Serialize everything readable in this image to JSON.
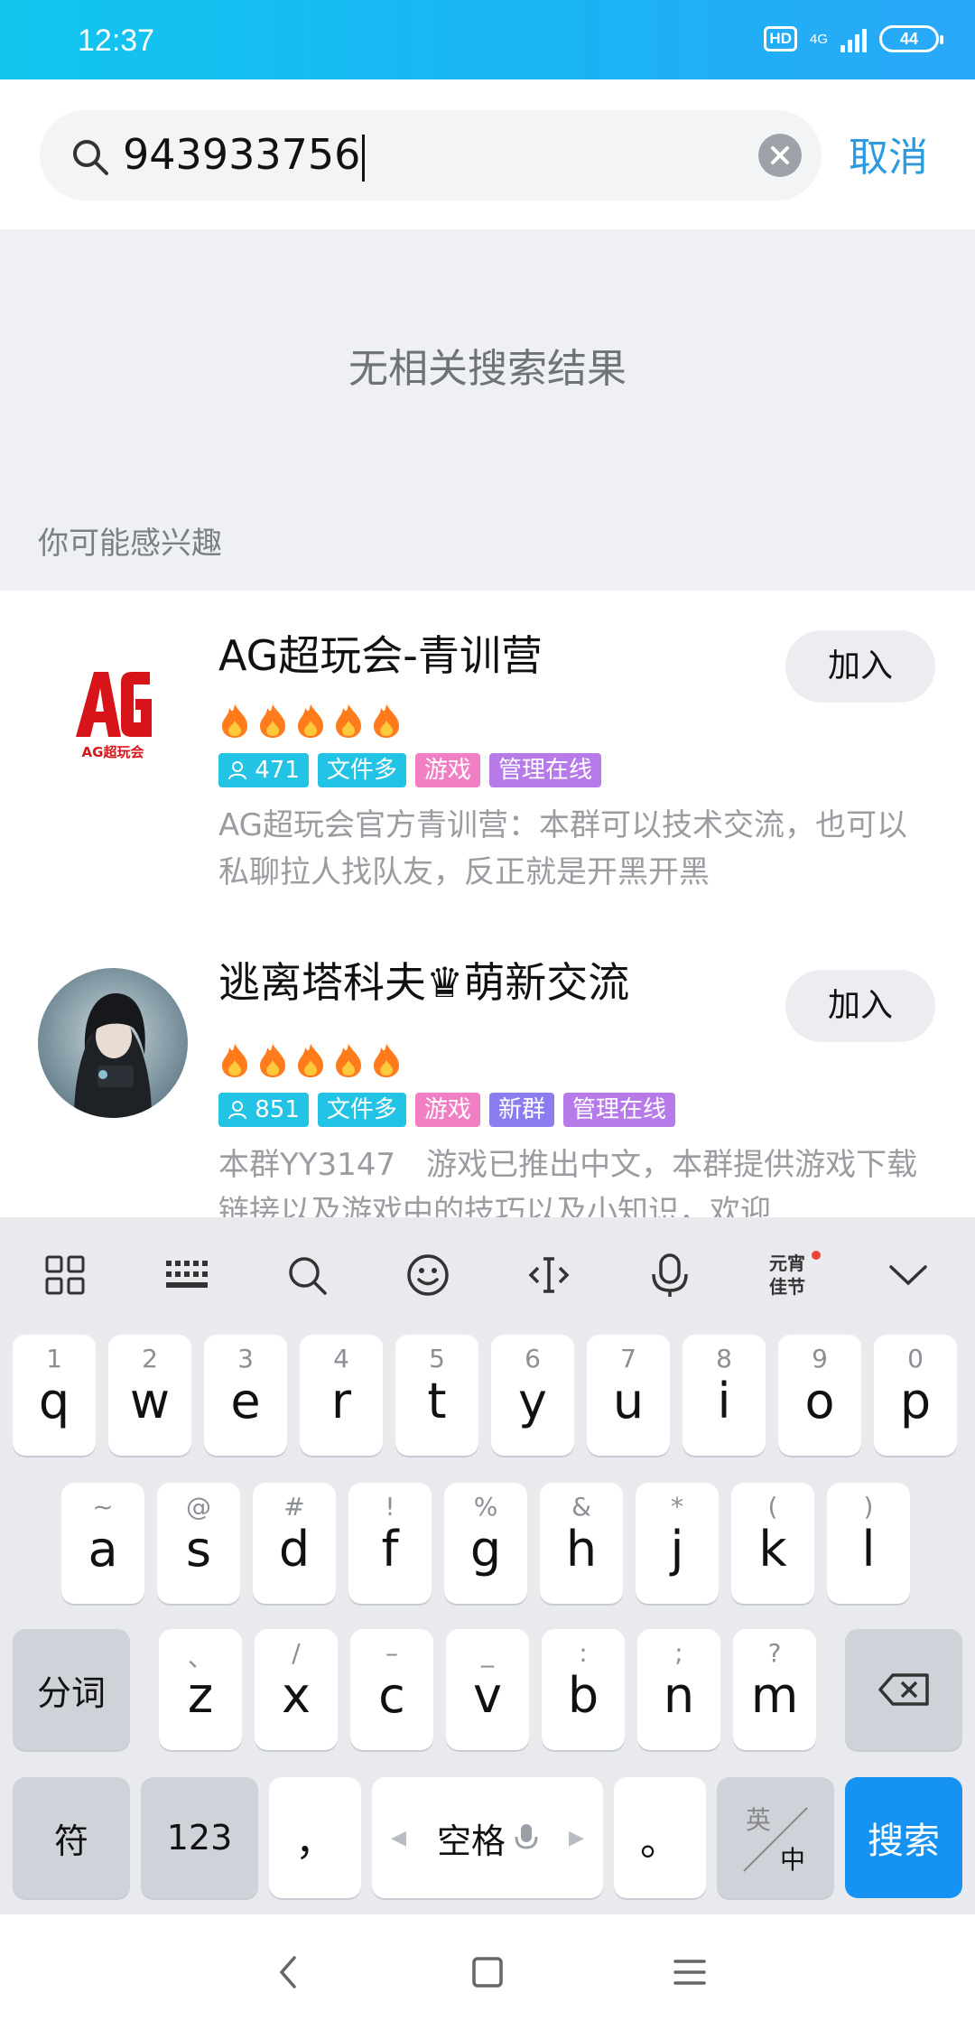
{
  "status_bar": {
    "time": "12:37",
    "hd": "HD",
    "network": "4G",
    "battery": "44"
  },
  "search": {
    "query": "943933756",
    "cancel_label": "取消"
  },
  "empty_state": {
    "message": "无相关搜索结果",
    "interest_label": "你可能感兴趣"
  },
  "results": [
    {
      "title": "AG超玩会-青训营",
      "fire_count": 5,
      "tags": [
        {
          "text": "471",
          "color": "#23c3e6",
          "icon": "person-icon"
        },
        {
          "text": "文件多",
          "color": "#23c3e6"
        },
        {
          "text": "游戏",
          "color": "#f27fc4"
        },
        {
          "text": "管理在线",
          "color": "#b67be8"
        }
      ],
      "description": "AG超玩会官方青训营：本群可以技术交流，也可以私聊拉人找队友，反正就是开黑开黑",
      "join_label": "加入",
      "avatar_logo": "AG超玩会"
    },
    {
      "title": "逃离塔科夫♛萌新交流",
      "fire_count": 5,
      "tags": [
        {
          "text": "851",
          "color": "#23c3e6",
          "icon": "person-icon"
        },
        {
          "text": "文件多",
          "color": "#23c3e6"
        },
        {
          "text": "游戏",
          "color": "#f27fc4"
        },
        {
          "text": "新群",
          "color": "#8b7cf0"
        },
        {
          "text": "管理在线",
          "color": "#b67be8"
        }
      ],
      "description": "本群YY3147　游戏已推出中文，本群提供游戏下载链接以及游戏中的技巧以及小知识，欢迎",
      "join_label": "加入"
    }
  ],
  "keyboard": {
    "toolbar_logo": "元宵佳节",
    "row1": [
      {
        "sub": "1",
        "main": "q"
      },
      {
        "sub": "2",
        "main": "w"
      },
      {
        "sub": "3",
        "main": "e"
      },
      {
        "sub": "4",
        "main": "r"
      },
      {
        "sub": "5",
        "main": "t"
      },
      {
        "sub": "6",
        "main": "y"
      },
      {
        "sub": "7",
        "main": "u"
      },
      {
        "sub": "8",
        "main": "i"
      },
      {
        "sub": "9",
        "main": "o"
      },
      {
        "sub": "0",
        "main": "p"
      }
    ],
    "row2": [
      {
        "sub": "~",
        "main": "a"
      },
      {
        "sub": "@",
        "main": "s"
      },
      {
        "sub": "#",
        "main": "d"
      },
      {
        "sub": "!",
        "main": "f"
      },
      {
        "sub": "%",
        "main": "g"
      },
      {
        "sub": "&",
        "main": "h"
      },
      {
        "sub": "*",
        "main": "j"
      },
      {
        "sub": "(",
        "main": "k"
      },
      {
        "sub": ")",
        "main": "l"
      }
    ],
    "row3": [
      {
        "sub": "、",
        "main": "z"
      },
      {
        "sub": "/",
        "main": "x"
      },
      {
        "sub": "–",
        "main": "c"
      },
      {
        "sub": "_",
        "main": "v"
      },
      {
        "sub": ":",
        "main": "b"
      },
      {
        "sub": ";",
        "main": "n"
      },
      {
        "sub": "?",
        "main": "m"
      }
    ],
    "fenci_label": "分词",
    "symbol_label": "符",
    "numbers_label": "123",
    "comma_label": "，",
    "space_label": "空格",
    "period_label": "。",
    "lang_en": "英",
    "lang_zh": "中",
    "search_label": "搜索"
  }
}
